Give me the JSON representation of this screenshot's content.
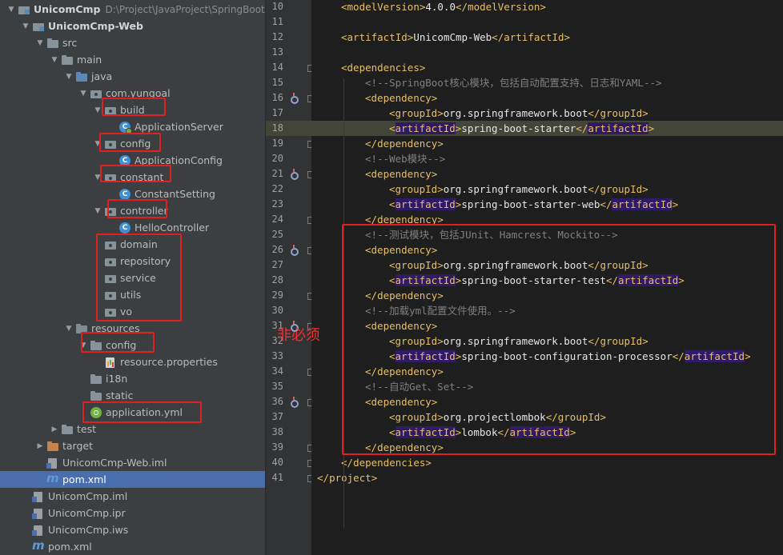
{
  "project_root": {
    "name": "UnicomCmp",
    "path": "D:\\Project\\JavaProject\\SpringBoot\\"
  },
  "tree": [
    {
      "id": "root",
      "label": "UnicomCmp",
      "bold": true,
      "level": 0,
      "arrow": "down",
      "icon": "module-icon"
    },
    {
      "id": "web",
      "label": "UnicomCmp-Web",
      "bold": true,
      "level": 1,
      "arrow": "down",
      "icon": "module-icon"
    },
    {
      "id": "src",
      "label": "src",
      "level": 2,
      "arrow": "down",
      "icon": "folder-icon"
    },
    {
      "id": "main",
      "label": "main",
      "level": 3,
      "arrow": "down",
      "icon": "folder-icon"
    },
    {
      "id": "java",
      "label": "java",
      "level": 4,
      "arrow": "down",
      "icon": "source-folder-icon"
    },
    {
      "id": "pkg",
      "label": "com.yungoal",
      "level": 5,
      "arrow": "down",
      "icon": "package-icon"
    },
    {
      "id": "build",
      "label": "build",
      "level": 6,
      "arrow": "down",
      "icon": "package-icon"
    },
    {
      "id": "appserver",
      "label": "ApplicationServer",
      "level": 7,
      "icon": "spring-class-icon"
    },
    {
      "id": "config",
      "label": "config",
      "level": 6,
      "arrow": "down",
      "icon": "package-icon"
    },
    {
      "id": "appconfig",
      "label": "ApplicationConfig",
      "level": 7,
      "icon": "class-icon"
    },
    {
      "id": "constant",
      "label": "constant",
      "level": 6,
      "arrow": "down",
      "icon": "package-icon"
    },
    {
      "id": "constsetting",
      "label": "ConstantSetting",
      "level": 7,
      "icon": "class-icon"
    },
    {
      "id": "controller",
      "label": "controller",
      "level": 6,
      "arrow": "down",
      "icon": "package-icon"
    },
    {
      "id": "hellocontroller",
      "label": "HelloController",
      "level": 7,
      "icon": "class-icon"
    },
    {
      "id": "domain",
      "label": "domain",
      "level": 6,
      "icon": "package-icon"
    },
    {
      "id": "repository",
      "label": "repository",
      "level": 6,
      "icon": "package-icon"
    },
    {
      "id": "service",
      "label": "service",
      "level": 6,
      "icon": "package-icon"
    },
    {
      "id": "utils",
      "label": "utils",
      "level": 6,
      "icon": "package-icon"
    },
    {
      "id": "vo",
      "label": "vo",
      "level": 6,
      "icon": "package-icon"
    },
    {
      "id": "resources",
      "label": "resources",
      "level": 4,
      "arrow": "down",
      "icon": "resources-folder-icon"
    },
    {
      "id": "resconfig",
      "label": "config",
      "level": 5,
      "arrow": "down",
      "icon": "folder-icon"
    },
    {
      "id": "resprops",
      "label": "resource.properties",
      "level": 6,
      "icon": "properties-file-icon"
    },
    {
      "id": "i18n",
      "label": "i18n",
      "level": 5,
      "icon": "folder-icon"
    },
    {
      "id": "static",
      "label": "static",
      "level": 5,
      "icon": "folder-icon"
    },
    {
      "id": "appyml",
      "label": "application.yml",
      "level": 5,
      "icon": "yml-file-icon"
    },
    {
      "id": "test",
      "label": "test",
      "level": 3,
      "arrow": "right",
      "icon": "folder-icon"
    },
    {
      "id": "target",
      "label": "target",
      "level": 2,
      "arrow": "right",
      "icon": "excluded-folder-icon"
    },
    {
      "id": "webiml",
      "label": "UnicomCmp-Web.iml",
      "level": 2,
      "icon": "iml-file-icon"
    },
    {
      "id": "webpom",
      "label": "pom.xml",
      "level": 2,
      "icon": "maven-pom-icon",
      "selected": true
    },
    {
      "id": "rootiml",
      "label": "UnicomCmp.iml",
      "level": 1,
      "icon": "iml-file-icon"
    },
    {
      "id": "rootipr",
      "label": "UnicomCmp.ipr",
      "level": 1,
      "icon": "iml-file-icon"
    },
    {
      "id": "rootiws",
      "label": "UnicomCmp.iws",
      "level": 1,
      "icon": "iml-file-icon"
    },
    {
      "id": "rootpom",
      "label": "pom.xml",
      "level": 1,
      "icon": "maven-pom-icon"
    }
  ],
  "code": [
    {
      "n": "10",
      "ind": 1,
      "parts": [
        [
          "br",
          "<"
        ],
        [
          "tg",
          "modelVersion"
        ],
        [
          "br",
          ">"
        ],
        [
          "tx",
          "4.0.0"
        ],
        [
          "br",
          "</"
        ],
        [
          "tg",
          "modelVersion"
        ],
        [
          "br",
          ">"
        ]
      ]
    },
    {
      "n": "11",
      "ind": 0,
      "parts": []
    },
    {
      "n": "12",
      "ind": 1,
      "parts": [
        [
          "br",
          "<"
        ],
        [
          "tg",
          "artifactId"
        ],
        [
          "br",
          ">"
        ],
        [
          "tx",
          "UnicomCmp-Web"
        ],
        [
          "br",
          "</"
        ],
        [
          "tg",
          "artifactId"
        ],
        [
          "br",
          ">"
        ]
      ]
    },
    {
      "n": "13",
      "ind": 0,
      "parts": []
    },
    {
      "n": "14",
      "ind": 1,
      "fold": true,
      "parts": [
        [
          "br",
          "<"
        ],
        [
          "tg",
          "dependencies"
        ],
        [
          "br",
          ">"
        ]
      ]
    },
    {
      "n": "15",
      "ind": 2,
      "parts": [
        [
          "cm",
          "<!--SpringBoot核心模块，包括自动配置支持、日志和YAML-->"
        ]
      ]
    },
    {
      "n": "16",
      "ind": 2,
      "fold": true,
      "icon": true,
      "parts": [
        [
          "br",
          "<"
        ],
        [
          "tg",
          "dependency"
        ],
        [
          "br",
          ">"
        ]
      ]
    },
    {
      "n": "17",
      "ind": 3,
      "parts": [
        [
          "br",
          "<"
        ],
        [
          "tg",
          "groupId"
        ],
        [
          "br",
          ">"
        ],
        [
          "tx",
          "org.springframework.boot"
        ],
        [
          "br",
          "</"
        ],
        [
          "tg",
          "groupId"
        ],
        [
          "br",
          ">"
        ]
      ]
    },
    {
      "n": "18",
      "ind": 3,
      "hl": true,
      "parts": [
        [
          "br",
          "<"
        ],
        [
          "tgbox",
          "artifactId"
        ],
        [
          "br",
          ">"
        ],
        [
          "tx",
          "spring-boot-starter"
        ],
        [
          "br",
          "</"
        ],
        [
          "tgbox",
          "artifactId"
        ],
        [
          "br",
          ">"
        ]
      ]
    },
    {
      "n": "19",
      "ind": 2,
      "fold": true,
      "parts": [
        [
          "br",
          "</"
        ],
        [
          "tg",
          "dependency"
        ],
        [
          "br",
          ">"
        ]
      ]
    },
    {
      "n": "20",
      "ind": 2,
      "parts": [
        [
          "cm",
          "<!--Web模块-->"
        ]
      ]
    },
    {
      "n": "21",
      "ind": 2,
      "fold": true,
      "icon": true,
      "parts": [
        [
          "br",
          "<"
        ],
        [
          "tg",
          "dependency"
        ],
        [
          "br",
          ">"
        ]
      ]
    },
    {
      "n": "22",
      "ind": 3,
      "parts": [
        [
          "br",
          "<"
        ],
        [
          "tg",
          "groupId"
        ],
        [
          "br",
          ">"
        ],
        [
          "tx",
          "org.springframework.boot"
        ],
        [
          "br",
          "</"
        ],
        [
          "tg",
          "groupId"
        ],
        [
          "br",
          ">"
        ]
      ]
    },
    {
      "n": "23",
      "ind": 3,
      "parts": [
        [
          "br",
          "<"
        ],
        [
          "tgbox",
          "artifactId"
        ],
        [
          "br",
          ">"
        ],
        [
          "tx",
          "spring-boot-starter-web"
        ],
        [
          "br",
          "</"
        ],
        [
          "tgbox",
          "artifactId"
        ],
        [
          "br",
          ">"
        ]
      ]
    },
    {
      "n": "24",
      "ind": 2,
      "fold": true,
      "parts": [
        [
          "br",
          "</"
        ],
        [
          "tg",
          "dependency"
        ],
        [
          "br",
          ">"
        ]
      ]
    },
    {
      "n": "25",
      "ind": 2,
      "parts": [
        [
          "cm",
          "<!--测试模块，包括JUnit、Hamcrest、Mockito-->"
        ]
      ]
    },
    {
      "n": "26",
      "ind": 2,
      "fold": true,
      "icon": true,
      "parts": [
        [
          "br",
          "<"
        ],
        [
          "tg",
          "dependency"
        ],
        [
          "br",
          ">"
        ]
      ]
    },
    {
      "n": "27",
      "ind": 3,
      "parts": [
        [
          "br",
          "<"
        ],
        [
          "tg",
          "groupId"
        ],
        [
          "br",
          ">"
        ],
        [
          "tx",
          "org.springframework.boot"
        ],
        [
          "br",
          "</"
        ],
        [
          "tg",
          "groupId"
        ],
        [
          "br",
          ">"
        ]
      ]
    },
    {
      "n": "28",
      "ind": 3,
      "parts": [
        [
          "br",
          "<"
        ],
        [
          "tgbox",
          "artifactId"
        ],
        [
          "br",
          ">"
        ],
        [
          "tx",
          "spring-boot-starter-test"
        ],
        [
          "br",
          "</"
        ],
        [
          "tgbox",
          "artifactId"
        ],
        [
          "br",
          ">"
        ]
      ]
    },
    {
      "n": "29",
      "ind": 2,
      "fold": true,
      "parts": [
        [
          "br",
          "</"
        ],
        [
          "tg",
          "dependency"
        ],
        [
          "br",
          ">"
        ]
      ]
    },
    {
      "n": "30",
      "ind": 2,
      "parts": [
        [
          "cm",
          "<!--加载yml配置文件使用。-->"
        ]
      ]
    },
    {
      "n": "31",
      "ind": 2,
      "fold": true,
      "icon": true,
      "parts": [
        [
          "br",
          "<"
        ],
        [
          "tg",
          "dependency"
        ],
        [
          "br",
          ">"
        ]
      ]
    },
    {
      "n": "32",
      "ind": 3,
      "parts": [
        [
          "br",
          "<"
        ],
        [
          "tg",
          "groupId"
        ],
        [
          "br",
          ">"
        ],
        [
          "tx",
          "org.springframework.boot"
        ],
        [
          "br",
          "</"
        ],
        [
          "tg",
          "groupId"
        ],
        [
          "br",
          ">"
        ]
      ]
    },
    {
      "n": "33",
      "ind": 3,
      "parts": [
        [
          "br",
          "<"
        ],
        [
          "tgbox",
          "artifactId"
        ],
        [
          "br",
          ">"
        ],
        [
          "tx",
          "spring-boot-configuration-processor"
        ],
        [
          "br",
          "</"
        ],
        [
          "tgbox",
          "artifactId"
        ],
        [
          "br",
          ">"
        ]
      ]
    },
    {
      "n": "34",
      "ind": 2,
      "fold": true,
      "parts": [
        [
          "br",
          "</"
        ],
        [
          "tg",
          "dependency"
        ],
        [
          "br",
          ">"
        ]
      ]
    },
    {
      "n": "35",
      "ind": 2,
      "parts": [
        [
          "cm",
          "<!--自动Get、Set-->"
        ]
      ]
    },
    {
      "n": "36",
      "ind": 2,
      "fold": true,
      "icon": true,
      "parts": [
        [
          "br",
          "<"
        ],
        [
          "tg",
          "dependency"
        ],
        [
          "br",
          ">"
        ]
      ]
    },
    {
      "n": "37",
      "ind": 3,
      "parts": [
        [
          "br",
          "<"
        ],
        [
          "tg",
          "groupId"
        ],
        [
          "br",
          ">"
        ],
        [
          "tx",
          "org.projectlombok"
        ],
        [
          "br",
          "</"
        ],
        [
          "tg",
          "groupId"
        ],
        [
          "br",
          ">"
        ]
      ]
    },
    {
      "n": "38",
      "ind": 3,
      "parts": [
        [
          "br",
          "<"
        ],
        [
          "tgbox",
          "artifactId"
        ],
        [
          "br",
          ">"
        ],
        [
          "tx",
          "lombok"
        ],
        [
          "br",
          "</"
        ],
        [
          "tgbox",
          "artifactId"
        ],
        [
          "br",
          ">"
        ]
      ]
    },
    {
      "n": "39",
      "ind": 2,
      "fold": true,
      "parts": [
        [
          "br",
          "</"
        ],
        [
          "tg",
          "dependency"
        ],
        [
          "br",
          ">"
        ]
      ]
    },
    {
      "n": "40",
      "ind": 1,
      "fold": true,
      "parts": [
        [
          "br",
          "</"
        ],
        [
          "tg",
          "dependencies"
        ],
        [
          "br",
          ">"
        ]
      ]
    },
    {
      "n": "41",
      "ind": 0,
      "fold": true,
      "parts": [
        [
          "br",
          "</"
        ],
        [
          "tg",
          "project"
        ],
        [
          "br",
          ">"
        ]
      ]
    }
  ],
  "annotation": {
    "text": "非必须",
    "color": "#e02020"
  },
  "colors": {
    "tree_bg": "#3c3f41",
    "editor_bg": "#1e1e1e",
    "selection": "#4b6eaf",
    "tag": "#e8bf6a",
    "comment": "#808080"
  }
}
